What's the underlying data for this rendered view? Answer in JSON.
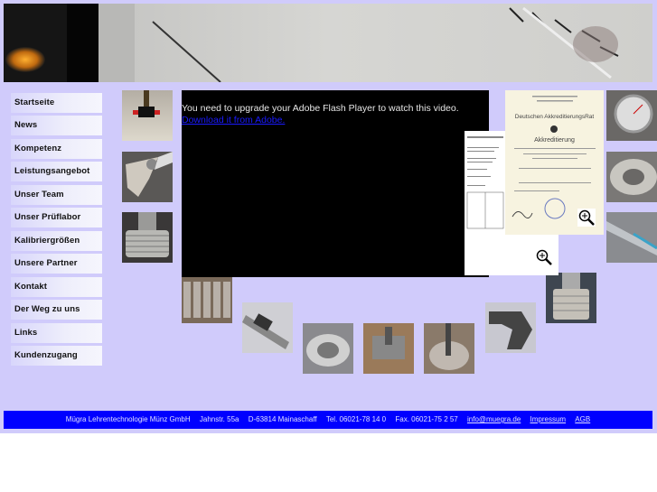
{
  "nav": {
    "items": [
      {
        "label": "Startseite"
      },
      {
        "label": "News"
      },
      {
        "label": "Kompetenz"
      },
      {
        "label": "Leistungsangebot"
      },
      {
        "label": "Unser Team"
      },
      {
        "label": "Unser Prüflabor"
      },
      {
        "label": "Kalibriergrößen"
      },
      {
        "label": "Unsere Partner"
      },
      {
        "label": "Kontakt"
      },
      {
        "label": "Der Weg zu uns"
      },
      {
        "label": "Links"
      },
      {
        "label": "Kundenzugang"
      }
    ]
  },
  "flash": {
    "message": "You need to upgrade your Adobe Flash Player to watch this video.",
    "download_link": "Download it from Adobe."
  },
  "certificates": {
    "accreditation_title": "Deutschen AkkreditierungsRat",
    "accreditation_heading": "Akkreditierung",
    "zoom_icon": "magnifier-plus-icon"
  },
  "footer": {
    "company": "Mügra Lehrentechnologie Münz GmbH",
    "street": "Jahnstr. 55a",
    "city": "D-63814 Mainaschaff",
    "phone": "Tel. 06021-78 14 0",
    "fax": "Fax. 06021-75 2 57",
    "email": "info@muegra.de",
    "imprint": "Impressum",
    "terms": "AGB"
  },
  "colors": {
    "background": "#d0cbfb",
    "footer": "#0000ff",
    "link": "#1a1aff"
  }
}
